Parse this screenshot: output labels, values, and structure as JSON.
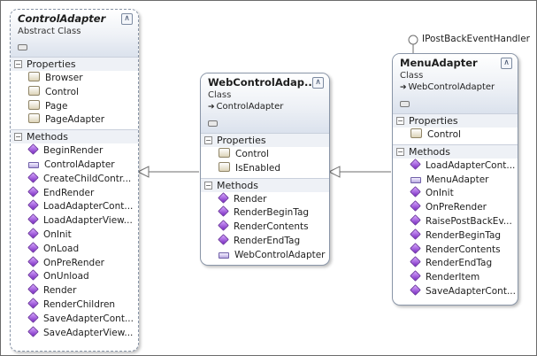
{
  "interface_label": "IPostBackEventHandler",
  "boxes": {
    "control_adapter": {
      "name": "ControlAdapter",
      "kind": "Abstract Class",
      "properties_label": "Properties",
      "methods_label": "Methods",
      "properties": [
        "Browser",
        "Control",
        "Page",
        "PageAdapter"
      ],
      "methods": [
        "BeginRender",
        "ControlAdapter",
        "CreateChildContr...",
        "EndRender",
        "LoadAdapterCont...",
        "LoadAdapterView...",
        "OnInit",
        "OnLoad",
        "OnPreRender",
        "OnUnload",
        "Render",
        "RenderChildren",
        "SaveAdapterCont...",
        "SaveAdapterView..."
      ]
    },
    "web_control_adapter": {
      "name": "WebControlAdap...",
      "kind": "Class",
      "inherits": "ControlAdapter",
      "properties_label": "Properties",
      "methods_label": "Methods",
      "properties": [
        "Control",
        "IsEnabled"
      ],
      "methods": [
        "Render",
        "RenderBeginTag",
        "RenderContents",
        "RenderEndTag",
        "WebControlAdapter"
      ]
    },
    "menu_adapter": {
      "name": "MenuAdapter",
      "kind": "Class",
      "inherits": "WebControlAdapter",
      "properties_label": "Properties",
      "methods_label": "Methods",
      "properties": [
        "Control"
      ],
      "methods": [
        "LoadAdapterCont...",
        "MenuAdapter",
        "OnInit",
        "OnPreRender",
        "RaisePostBackEv...",
        "RenderBeginTag",
        "RenderContents",
        "RenderEndTag",
        "RenderItem",
        "SaveAdapterCont..."
      ]
    }
  }
}
